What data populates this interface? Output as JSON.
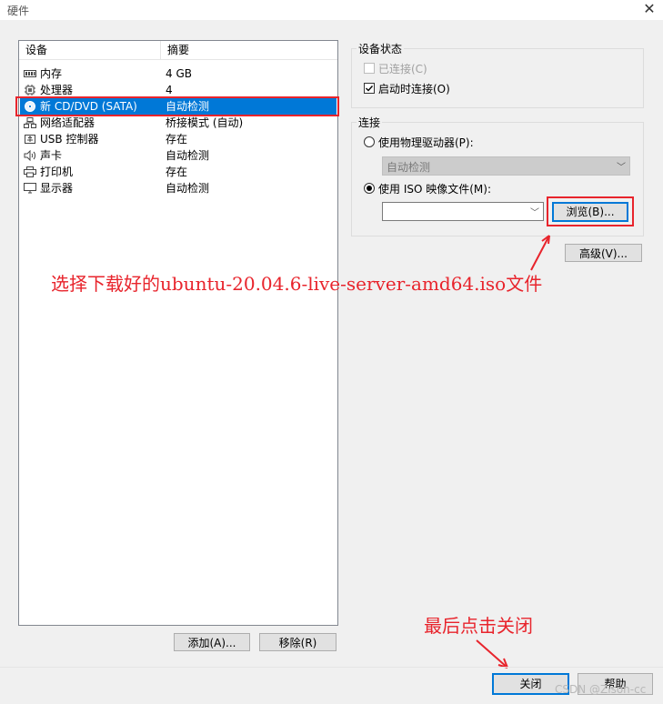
{
  "window": {
    "title": "硬件",
    "close_glyph": "✕"
  },
  "device_list": {
    "columns": {
      "device": "设备",
      "summary": "摘要"
    },
    "rows": [
      {
        "name": "内存",
        "summary": "4 GB",
        "icon": "memory-icon"
      },
      {
        "name": "处理器",
        "summary": "4",
        "icon": "processor-icon"
      },
      {
        "name": "新 CD/DVD (SATA)",
        "summary": "自动检测",
        "icon": "cd-icon",
        "selected": true
      },
      {
        "name": "网络适配器",
        "summary": "桥接模式 (自动)",
        "icon": "network-icon"
      },
      {
        "name": "USB 控制器",
        "summary": "存在",
        "icon": "usb-icon"
      },
      {
        "name": "声卡",
        "summary": "自动检测",
        "icon": "speaker-icon"
      },
      {
        "name": "打印机",
        "summary": "存在",
        "icon": "printer-icon"
      },
      {
        "name": "显示器",
        "summary": "自动检测",
        "icon": "monitor-icon"
      }
    ],
    "add_label": "添加(A)...",
    "remove_label": "移除(R)"
  },
  "device_status": {
    "group_label": "设备状态",
    "connected_label": "已连接(C)",
    "connected_checked": false,
    "connect_at_poweron_label": "启动时连接(O)",
    "connect_at_poweron_checked": true
  },
  "connection": {
    "group_label": "连接",
    "physical_drive_label": "使用物理驱动器(P):",
    "physical_drive_value": "自动检测",
    "iso_label": "使用 ISO 映像文件(M):",
    "iso_value": "",
    "browse_label": "浏览(B)...",
    "selected": "iso"
  },
  "advanced_label": "高级(V)...",
  "annotations": {
    "browse_hint": "选择下载好的ubuntu-20.04.6-live-server-amd64.iso文件",
    "close_hint": "最后点击关闭"
  },
  "footer": {
    "close_label": "关闭",
    "help_label": "帮助"
  },
  "watermark": "CSDN @Zison-cc",
  "colors": {
    "accent": "#0078d7",
    "annotation_red": "#e8242c",
    "window_bg": "#f0f0f0"
  }
}
